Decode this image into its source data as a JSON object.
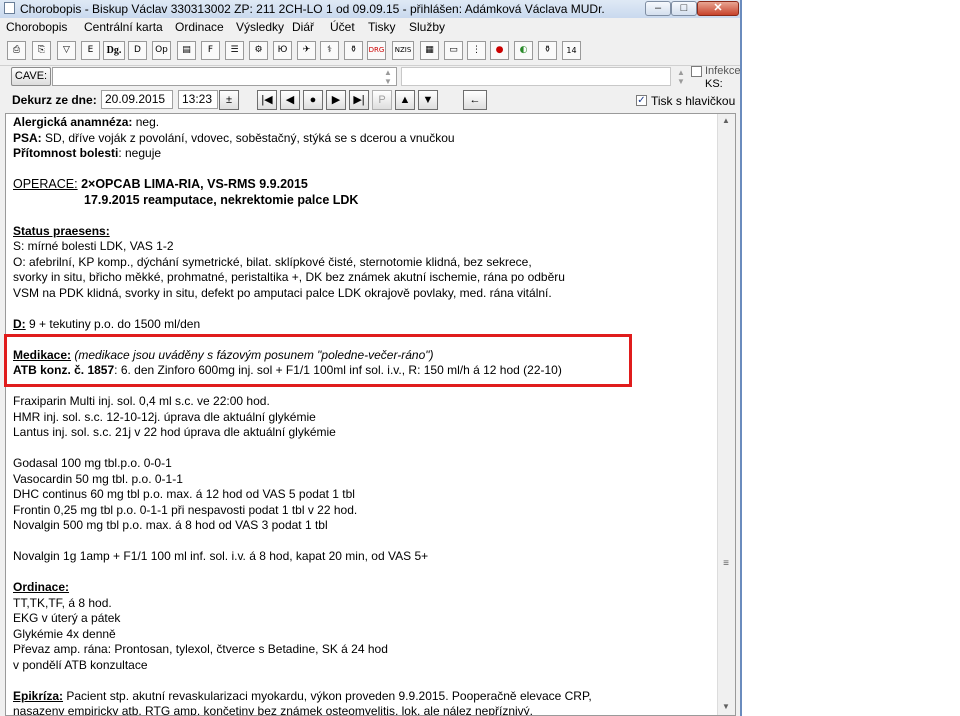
{
  "window": {
    "title": "Chorobopis - Biskup Václav  330313002    ZP: 211 2CH-LO 1 od 09.09.15 - přihlášen: Adámková Václava MUDr.",
    "min_glyph": "–",
    "max_glyph": "□",
    "close_glyph": "✕"
  },
  "menu": [
    "Chorobopis",
    "Centrální karta",
    "Ordinace",
    "Výsledky",
    "Diář",
    "Účet",
    "Tisky",
    "Služby"
  ],
  "toolbar": {
    "glyphs": [
      "⎙",
      "⎘",
      "▽",
      "E",
      "Dg.",
      "D",
      "Op",
      "▤",
      "F",
      "☰",
      "⚙",
      "Ю",
      "✈",
      "⚕",
      "⚱",
      "DRG",
      "NZIS",
      "▦",
      "▭",
      "⋮",
      "●",
      "◐",
      "⚱"
    ]
  },
  "cave": {
    "button_label": "CAVE:",
    "value": "",
    "infekce_label": "Infekce",
    "ks_label": "KS:"
  },
  "dekurz": {
    "label": "Dekurz ze dne:",
    "date": "20.09.2015",
    "time": "13:23",
    "time_btn": "±",
    "nav": [
      "|◀",
      "◀",
      "●",
      "▶",
      "▶|",
      "P",
      "▲",
      "▼"
    ],
    "back_btn": "←",
    "tisk_label": "Tisk s hlavičkou",
    "tisk_checked": "✓"
  },
  "doc": {
    "alergicka_label": "Alergická anamnéza:",
    "alergicka_value": " neg.",
    "psa_label": "PSA:",
    "psa_value": " SD, dříve voják z povolání, vdovec, soběstačný, stýká se s dcerou a vnučkou",
    "bolest_label": "Přítomnost bolesti",
    "bolest_value": ": neguje",
    "operace_label": "OPERACE:",
    "operace_1": " 2×OPCAB LIMA-RIA, VS-RMS 9.9.2015",
    "operace_2": "17.9.2015 reamputace, nekrektomie palce LDK",
    "status_label": "Status praesens:",
    "status_lines": [
      "S: mírné bolesti LDK, VAS 1-2",
      "O: afebrilní, KP komp., dýchání symetrické, bilat. sklípkové čisté, sternotomie klidná, bez sekrece,",
      "svorky in situ, břicho měkké, prohmatné, peristaltika +, DK bez známek akutní ischemie, rána po odběru",
      "VSM na PDK klidná, svorky in situ,  defekt po amputaci palce LDK okrajově povlaky, med. rána vitální."
    ],
    "d_label": "D:",
    "d_value": " 9 + tekutiny p.o. do 1500 ml/den",
    "medikace_label": "Medikace:",
    "medikace_note": " (medikace jsou uváděny s fázovým posunem \"poledne-večer-ráno\")",
    "atb_label": "ATB konz. č. 1857",
    "atb_value": ": 6. den Zinforo 600mg inj. sol + F1/1 100ml inf sol. i.v., R: 150 ml/h á 12 hod  (22-10)",
    "meds_1": [
      "Fraxiparin Multi inj. sol. 0,4 ml s.c. ve 22:00 hod.",
      "HMR inj. sol. s.c.  12-10-12j.   úprava  dle aktuální glykémie",
      "Lantus inj. sol. s.c. 21j v 22 hod   úprava dle aktuální glykémie"
    ],
    "meds_2": [
      "Godasal 100 mg tbl.p.o. 0-0-1",
      "Vasocardin 50 mg tbl. p.o.  0-1-1",
      "DHC continus 60 mg tbl p.o. max. á 12 hod od VAS 5 podat 1 tbl",
      "Frontin 0,25 mg tbl p.o. 0-1-1 při nespavosti podat 1 tbl v 22 hod.",
      "Novalgin 500 mg tbl p.o. max. á 8 hod od VAS 3 podat 1 tbl"
    ],
    "meds_3": "Novalgin 1g 1amp + F1/1 100 ml inf. sol. i.v. á 8 hod, kapat 20 min, od VAS 5+",
    "ordinace_label": "Ordinace:",
    "ordinace_lines": [
      "TT,TK,TF, á 8 hod.",
      "EKG v úterý a pátek",
      "Glykémie 4x denně",
      "Převaz amp. rána: Prontosan, tylexol, čtverce s Betadine, SK á 24 hod",
      "v pondělí ATB konzultace"
    ],
    "epikriza_label": "Epikríza:",
    "epikriza_lines": [
      " Pacient stp. akutní revaskularizaci myokardu, výkon proveden 9.9.2015. Pooperačně elevace CRP,",
      "nasazeny empiricky atb. RTG amp. končetiny bez známek osteomyelitis, lok. ale nález nepříznivý."
    ]
  },
  "scroll": {
    "up": "▲",
    "down": "▼",
    "grip": "≡"
  }
}
